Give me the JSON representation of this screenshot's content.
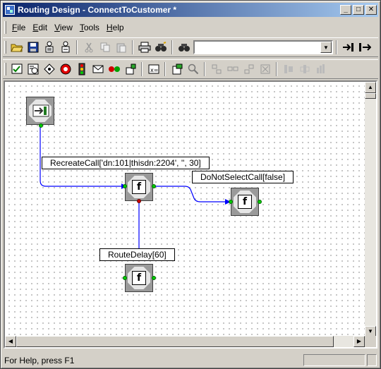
{
  "window": {
    "title": "Routing Design - ConnectToCustomer *",
    "minimize_glyph": "_",
    "maximize_glyph": "□",
    "close_glyph": "✕"
  },
  "menu": {
    "items": [
      {
        "mnemonic": "F",
        "rest": "ile"
      },
      {
        "mnemonic": "E",
        "rest": "dit"
      },
      {
        "mnemonic": "V",
        "rest": "iew"
      },
      {
        "mnemonic": "T",
        "rest": "ools"
      },
      {
        "mnemonic": "H",
        "rest": "elp"
      }
    ]
  },
  "toolbar": {
    "search_value": "",
    "icons_row1": [
      "open-folder",
      "save",
      "deploy",
      "undeploy",
      "cut",
      "copy",
      "paste",
      "print",
      "find",
      "find-binoculars",
      "jump-to",
      "jump-from"
    ],
    "icons_row2": [
      "validate",
      "variables",
      "target-select",
      "stop",
      "traffic-light",
      "mail",
      "record",
      "subroutine",
      "script",
      "query",
      "zoom",
      "align-left",
      "align-center",
      "align-right",
      "delete",
      "layout-h1",
      "layout-h2",
      "layout-v"
    ]
  },
  "diagram": {
    "labels": {
      "recreate_call": "RecreateCall['dn:101|thisdn:2204', '', 30]",
      "do_not_select_call": "DoNotSelectCall[false]",
      "route_delay": "RouteDelay[60]"
    },
    "function_glyph": "f",
    "colors": {
      "link": "#0000ff",
      "port_in": "#00cc00",
      "port_out": "#cc0000",
      "node_frame": "#9a9a9a"
    }
  },
  "status": {
    "text": "For Help, press F1"
  }
}
